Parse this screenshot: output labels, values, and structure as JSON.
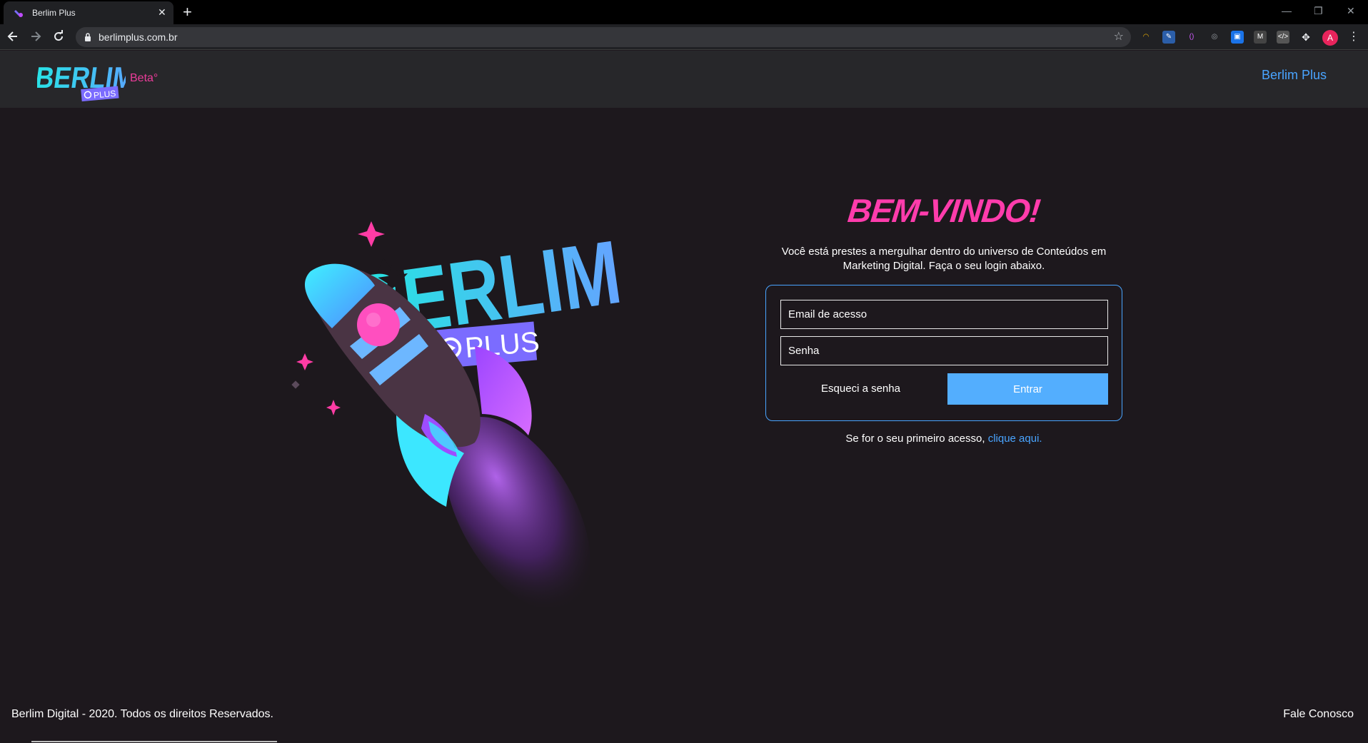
{
  "browser": {
    "tab_title": "Berlim Plus",
    "url": "berlimplus.com.br",
    "avatar_letter": "A"
  },
  "header": {
    "logo_text": "BERLIM",
    "logo_badge": "PLUS",
    "beta_label": "Beta°",
    "nav_link": "Berlim Plus"
  },
  "hero": {
    "logo_text": "BERLIM",
    "logo_badge": "PLUS"
  },
  "login": {
    "title": "BEM-VINDO!",
    "intro": "Você está prestes a mergulhar dentro do universo de Conteúdos em Marketing Digital. Faça o seu login abaixo.",
    "email_placeholder": "Email de acesso",
    "password_placeholder": "Senha",
    "forgot_label": "Esqueci a senha",
    "submit_label": "Entrar",
    "first_access_text": "Se for o seu primeiro acesso,",
    "first_access_link": "clique aqui."
  },
  "footer": {
    "copyright": "Berlim Digital - 2020. Todos os direitos Reservados.",
    "contact": "Fale Conosco"
  },
  "colors": {
    "accent_pink": "#ff3cac",
    "accent_blue": "#49a4ff",
    "button_blue": "#53aefe",
    "background": "#1d181d"
  }
}
